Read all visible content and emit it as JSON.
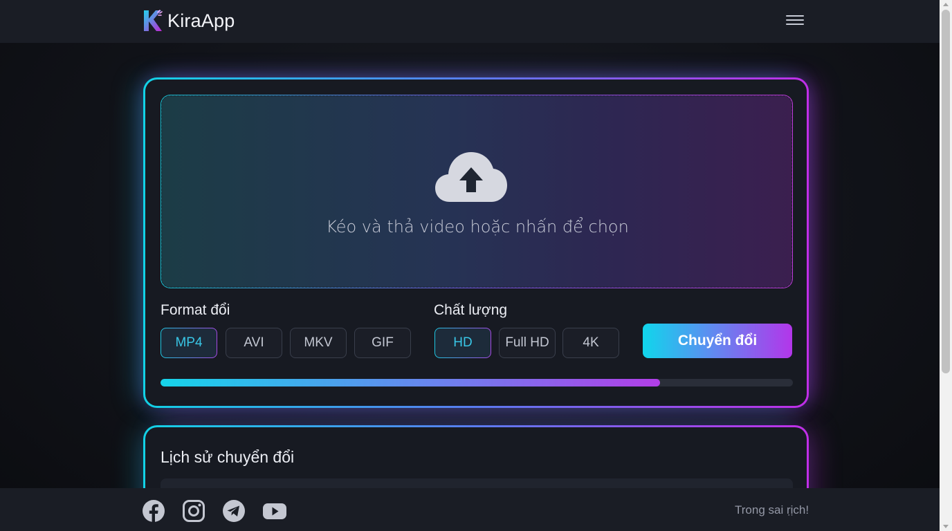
{
  "header": {
    "app_name": "KiraApp",
    "logo_icon": "kira-k-logo",
    "menu_icon": "hamburger-menu-icon"
  },
  "converter": {
    "dropzone_text": "Kéo và thả video hoặc nhấn để chọn",
    "upload_icon": "cloud-upload-icon",
    "format_label": "Format đổi",
    "formats": [
      "MP4",
      "AVI",
      "MKV",
      "GIF"
    ],
    "selected_format": "MP4",
    "quality_label": "Chất lượng",
    "qualities": [
      "HD",
      "Full HD",
      "4K"
    ],
    "selected_quality": "HD",
    "convert_label": "Chuyển đổi",
    "progress": 0.79,
    "accent_start": "#10d6ec",
    "accent_end": "#b336ea"
  },
  "history": {
    "title": "Lịch sử chuyển đổi"
  },
  "footer": {
    "social_icons": [
      "facebook-icon",
      "instagram-icon",
      "telegram-icon",
      "youtube-icon"
    ],
    "text": "Trong sai ṛịch!"
  }
}
